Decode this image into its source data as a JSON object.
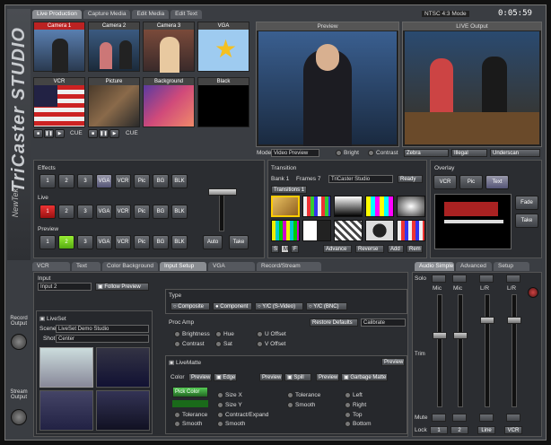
{
  "brand": {
    "name": "TriCaster STUDIO",
    "maker": "NewTek"
  },
  "top_tabs": [
    "Live Production",
    "Capture Media",
    "Edit Media",
    "Edit Text"
  ],
  "status": {
    "format": "NTSC 4:3 Mode",
    "clock": "0:05:59"
  },
  "sources": [
    "Camera 1",
    "Camera 2",
    "Camera 3",
    "VGA",
    "VCR",
    "Picture",
    "Background",
    "Black"
  ],
  "vcr_cue": "CUE",
  "picture_cue": "CUE",
  "preview": {
    "title": "Preview",
    "mode_label": "Mode",
    "mode_value": "Video Preview",
    "bright": "Bright",
    "contrast": "Contrast"
  },
  "live_output": {
    "title": "LIVE Output",
    "zebra": "Zebra",
    "illegal": "Illegal",
    "underscan": "Underscan"
  },
  "rows": {
    "effects": {
      "label": "Effects",
      "buttons": [
        "1",
        "2",
        "3",
        "VGA",
        "VCR",
        "Pic",
        "BG",
        "BLK"
      ]
    },
    "live": {
      "label": "Live",
      "buttons": [
        "1",
        "2",
        "3",
        "VGA",
        "VCR",
        "Pic",
        "BG",
        "BLK"
      ]
    },
    "preview": {
      "label": "Preview",
      "buttons": [
        "1",
        "2",
        "3",
        "VGA",
        "VCR",
        "Pic",
        "BG",
        "BLK"
      ]
    }
  },
  "tbar": {
    "auto": "Auto",
    "take": "Take"
  },
  "transition": {
    "title": "Transition",
    "bank": "Bank",
    "bank_num": "1",
    "frames": "Frames",
    "frames_num": "7",
    "preset": "TriCaster Studio",
    "ready": "Ready",
    "tab": "Transitions 1",
    "s": "S",
    "m": "M",
    "f": "F",
    "advance": "Advance",
    "reverse": "Reverse",
    "add": "Add",
    "rem": "Rem"
  },
  "overlay": {
    "title": "Overlay",
    "buttons": [
      "VCR",
      "Pic",
      "Text"
    ],
    "fade": "Fade",
    "take": "Take"
  },
  "bottom_tabs": [
    "VCR",
    "Text",
    "Color Background",
    "Input Setup",
    "VGA",
    "Record/Stream"
  ],
  "input": {
    "label": "Input",
    "value": "Input 2",
    "follow": "Follow Preview"
  },
  "liveset": {
    "label": "LiveSet",
    "scene_label": "Scene",
    "scene_value": "LiveSet Demo Studio",
    "shot_label": "Shot",
    "shot_value": "Center"
  },
  "type": {
    "label": "Type",
    "options": [
      "Composite",
      "Component",
      "Y/C (S-Video)",
      "Y/C (BNC)"
    ]
  },
  "proc_amp": {
    "label": "Proc Amp",
    "restore": "Restore Defaults",
    "calibrate": "Calibrate",
    "knobs": [
      "Brightness",
      "Hue",
      "U Offset",
      "Contrast",
      "Sat",
      "V Offset"
    ]
  },
  "livematte": {
    "label": "LiveMatte",
    "preview": "Preview",
    "color": "Color",
    "edge": "Edge",
    "spill": "Spill",
    "garbage": "Garbage Matte",
    "pick_color": "Pick Color",
    "tolerance": "Tolerance",
    "smooth": "Smooth",
    "size_x": "Size X",
    "size_y": "Size Y",
    "contract": "Contract/Expand",
    "smooth2": "Smooth",
    "tolerance2": "Tolerance",
    "smooth3": "Smooth",
    "left": "Left",
    "right": "Right",
    "top": "Top",
    "bottom": "Bottom"
  },
  "audio": {
    "tabs": [
      "Audio Simple",
      "Advanced",
      "Setup"
    ],
    "solo": "Solo",
    "mute": "Mute",
    "lock": "Lock",
    "channels": [
      "Mic",
      "Mic",
      "L/R",
      "L/R"
    ],
    "bottom": [
      "1",
      "2",
      "Line",
      "VCR"
    ],
    "trim": "Trim"
  },
  "side": {
    "record": "Record Output",
    "stream": "Stream Output"
  }
}
